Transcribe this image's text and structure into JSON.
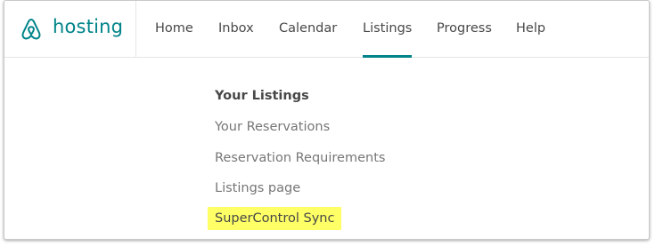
{
  "brand": {
    "name": "hosting",
    "accent_color": "#008489",
    "logo_icon": "airbnb-belo-icon"
  },
  "nav": [
    {
      "label": "Home",
      "active": false
    },
    {
      "label": "Inbox",
      "active": false
    },
    {
      "label": "Calendar",
      "active": false
    },
    {
      "label": "Listings",
      "active": true
    },
    {
      "label": "Progress",
      "active": false
    },
    {
      "label": "Help",
      "active": false
    }
  ],
  "menu": [
    {
      "label": "Your Listings",
      "selected": true
    },
    {
      "label": "Your Reservations",
      "selected": false
    },
    {
      "label": "Reservation Requirements",
      "selected": false
    },
    {
      "label": "Listings page",
      "selected": false
    },
    {
      "label": "SuperControl Sync",
      "selected": false,
      "highlighted": true
    }
  ],
  "colors": {
    "highlight": "#ffff66",
    "text": "#484848",
    "muted_text": "#767676"
  }
}
